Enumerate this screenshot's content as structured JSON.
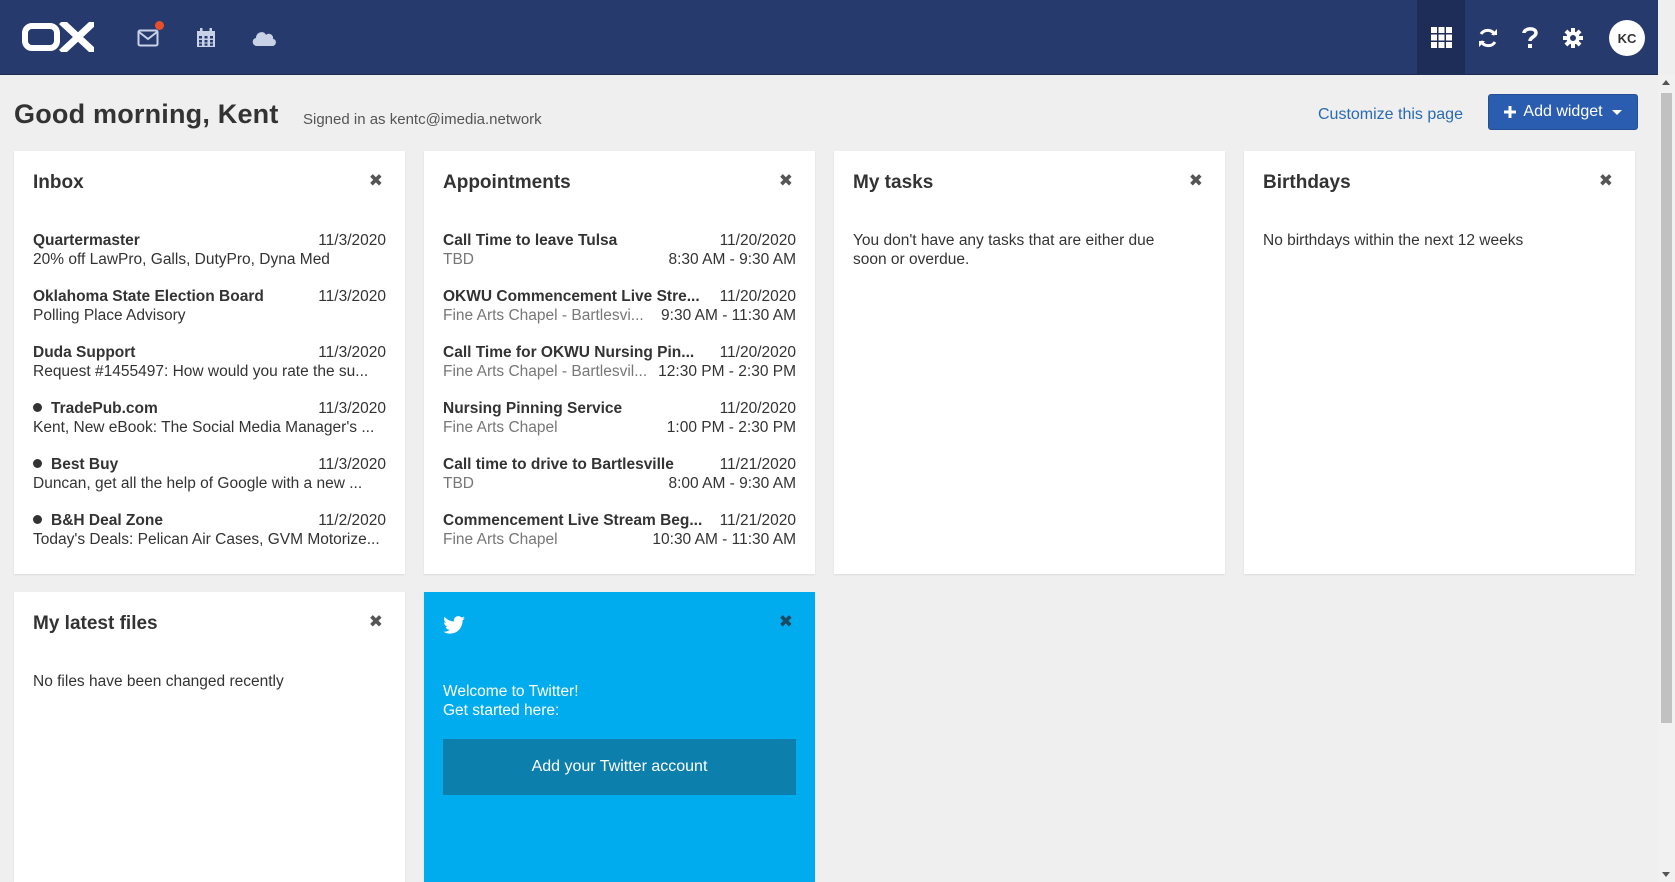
{
  "topbar": {
    "brand_color": "#263a6e",
    "icons": [
      "mail-icon",
      "calendar-icon",
      "cloud-icon",
      "apps-grid-icon",
      "refresh-icon",
      "help-icon",
      "settings-gear-icon"
    ],
    "avatar_initials": "KC"
  },
  "header": {
    "greeting": "Good morning, Kent",
    "signed_in": "Signed in as kentc@imedia.network",
    "customize_label": "Customize this page",
    "add_widget_label": "Add widget"
  },
  "inbox": {
    "title": "Inbox",
    "items": [
      {
        "from": "Quartermaster",
        "date": "11/3/2020",
        "subject": "20% off LawPro, Galls, DutyPro, Dyna Med",
        "unread": false
      },
      {
        "from": "Oklahoma State Election Board",
        "date": "11/3/2020",
        "subject": "Polling Place Advisory",
        "unread": false
      },
      {
        "from": "Duda Support",
        "date": "11/3/2020",
        "subject": "Request #1455497: How would you rate the su...",
        "unread": false
      },
      {
        "from": "TradePub.com",
        "date": "11/3/2020",
        "subject": "Kent, New eBook: The Social Media Manager's ...",
        "unread": true
      },
      {
        "from": "Best Buy",
        "date": "11/3/2020",
        "subject": "Duncan, get all the help of Google with a new ...",
        "unread": true
      },
      {
        "from": "B&H Deal Zone",
        "date": "11/2/2020",
        "subject": "Today's Deals: Pelican Air Cases, GVM Motorize...",
        "unread": true
      }
    ]
  },
  "appointments": {
    "title": "Appointments",
    "items": [
      {
        "title": "Call Time to leave Tulsa",
        "date": "11/20/2020",
        "location": "TBD",
        "time": "8:30 AM - 9:30 AM"
      },
      {
        "title": "OKWU Commencement Live Stre...",
        "date": "11/20/2020",
        "location": "Fine Arts Chapel - Bartlesvi...",
        "time": "9:30 AM - 11:30 AM"
      },
      {
        "title": "Call Time for OKWU Nursing Pin...",
        "date": "11/20/2020",
        "location": "Fine Arts Chapel - Bartlesvil...",
        "time": "12:30 PM - 2:30 PM"
      },
      {
        "title": "Nursing Pinning Service",
        "date": "11/20/2020",
        "location": "Fine Arts Chapel",
        "time": "1:00 PM - 2:30 PM"
      },
      {
        "title": "Call time to drive to Bartlesville",
        "date": "11/21/2020",
        "location": "TBD",
        "time": "8:00 AM - 9:30 AM"
      },
      {
        "title": "Commencement Live Stream Beg...",
        "date": "11/21/2020",
        "location": "Fine Arts Chapel",
        "time": "10:30 AM - 11:30 AM"
      }
    ]
  },
  "tasks": {
    "title": "My tasks",
    "empty_line1": "You don't have any tasks that are either due",
    "empty_line2": "soon or overdue."
  },
  "birthdays": {
    "title": "Birthdays",
    "empty": "No birthdays within the next 12 weeks"
  },
  "files": {
    "title": "My latest files",
    "empty": "No files have been changed recently"
  },
  "twitter": {
    "color": "#00aced",
    "line1": "Welcome to Twitter!",
    "line2": "Get started here:",
    "button_label": "Add your Twitter account"
  },
  "close_glyph": "✖"
}
